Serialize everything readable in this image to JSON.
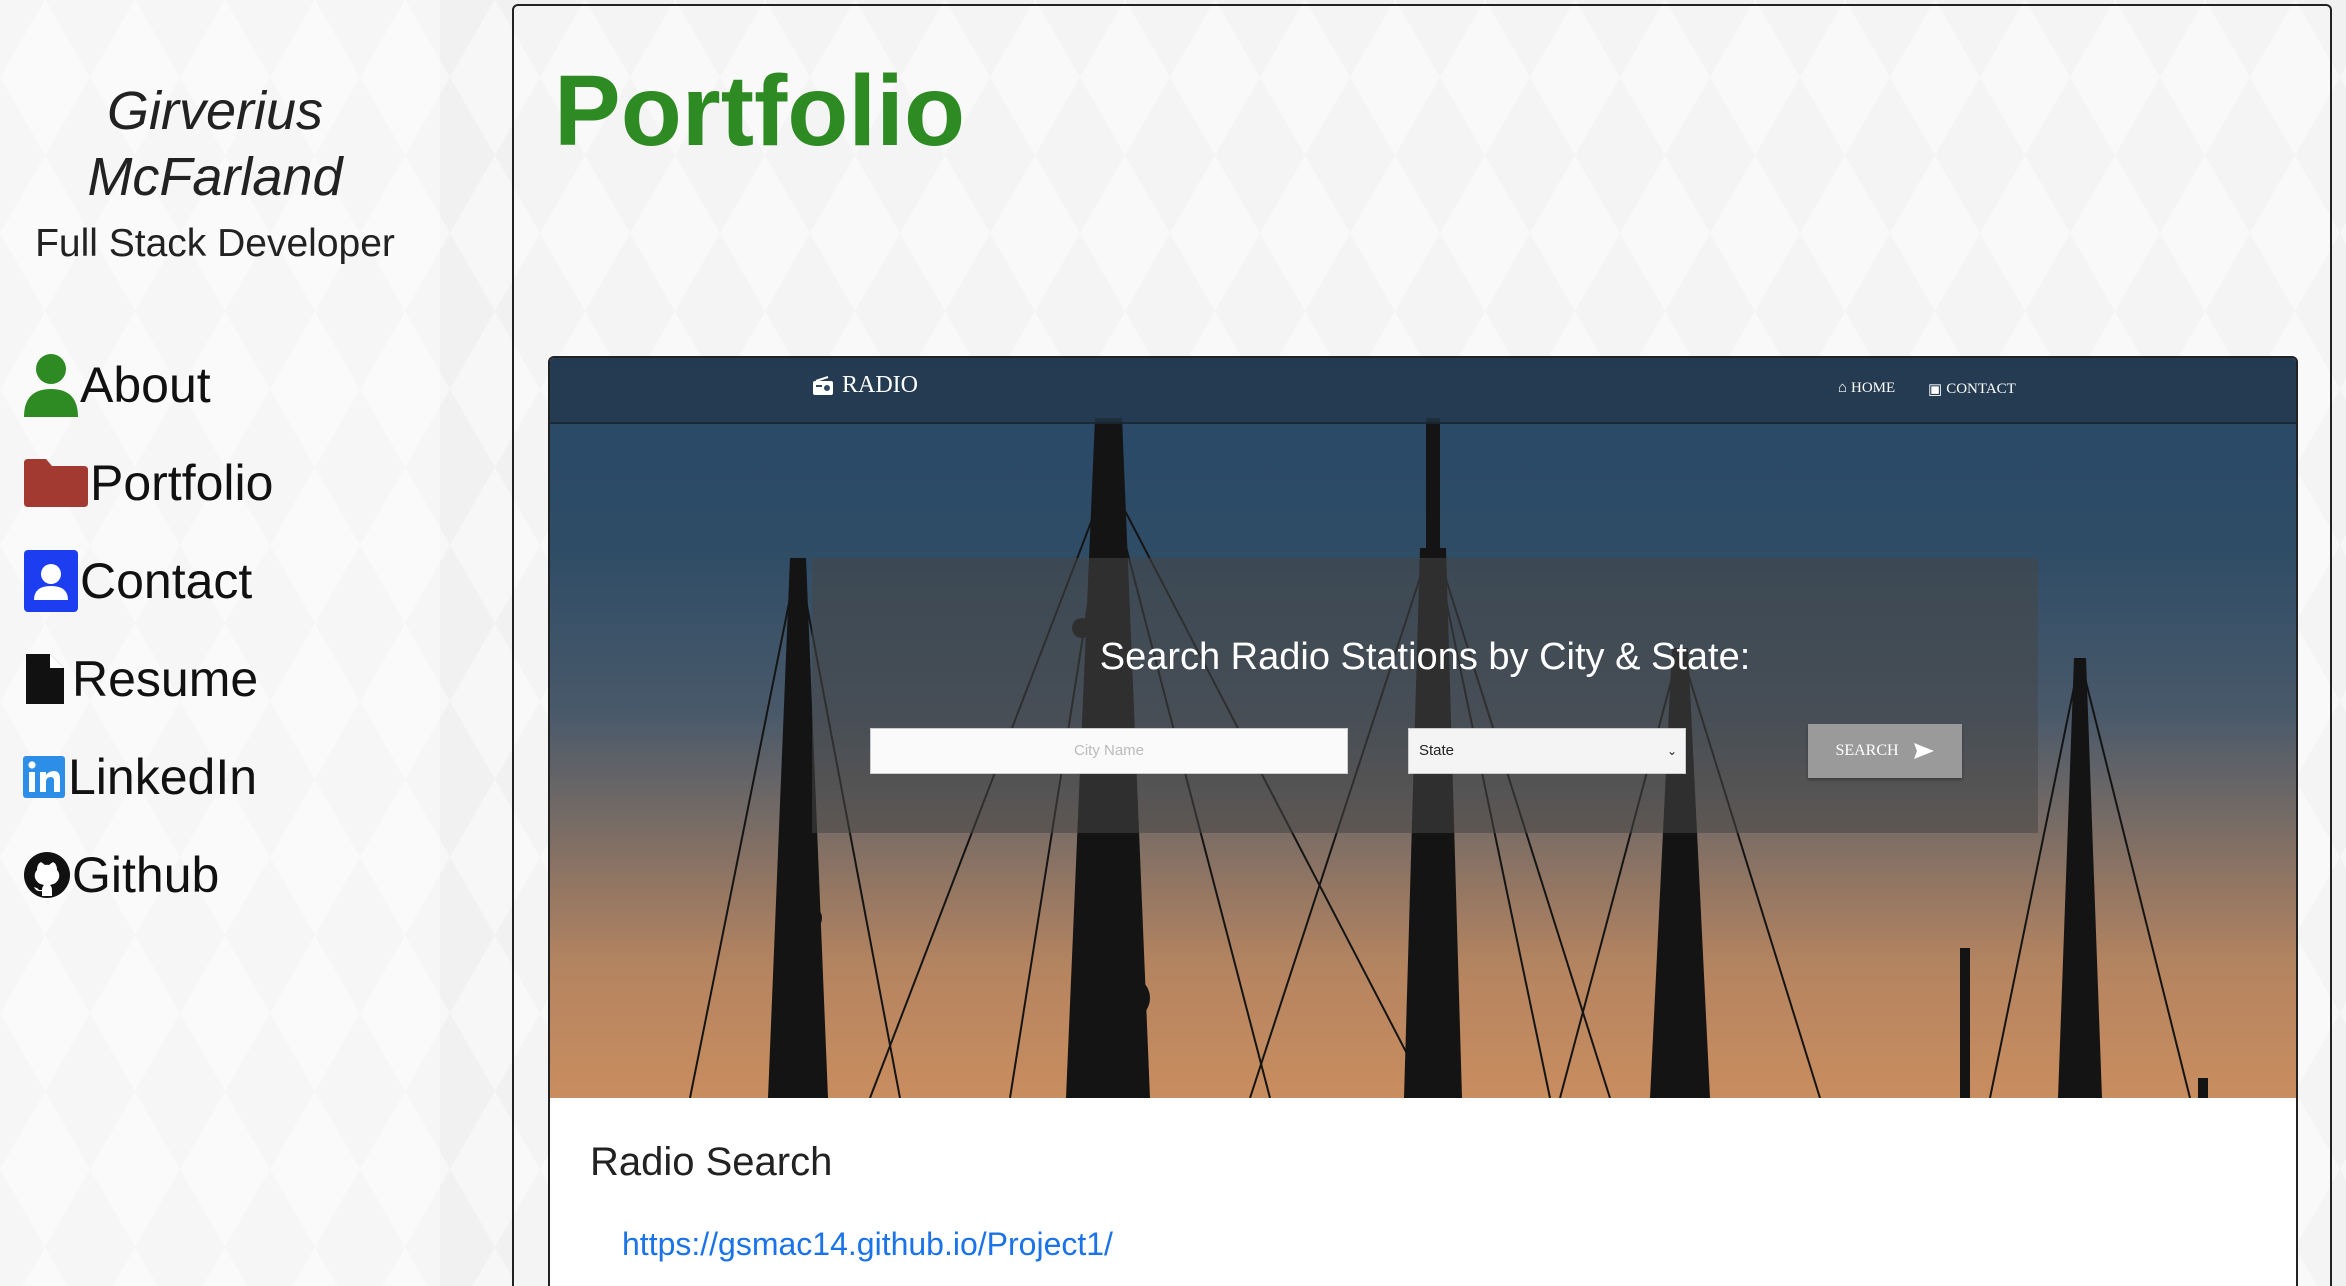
{
  "profile": {
    "name_first": "Girverius",
    "name_last": "McFarland",
    "role": "Full Stack Developer"
  },
  "nav": {
    "items": [
      {
        "label": "About",
        "icon": "person-icon",
        "color": "#2e8b23"
      },
      {
        "label": "Portfolio",
        "icon": "folder-icon",
        "color": "#a33a32"
      },
      {
        "label": "Contact",
        "icon": "contact-card-icon",
        "color": "#1c3ef0"
      },
      {
        "label": "Resume",
        "icon": "file-icon",
        "color": "#111111"
      },
      {
        "label": "LinkedIn",
        "icon": "linkedin-icon",
        "color": "#2d8ee8"
      },
      {
        "label": "Github",
        "icon": "github-icon",
        "color": "#111111"
      }
    ]
  },
  "main": {
    "title": "Portfolio",
    "title_color": "#2e8b23",
    "project": {
      "screenshot": {
        "brand": "RADIO",
        "nav_home": "HOME",
        "nav_contact": "CONTACT",
        "heading": "Search Radio Stations by City & State:",
        "city_placeholder": "City Name",
        "state_value": "State",
        "search_label": "SEARCH"
      },
      "title": "Radio Search",
      "link": "https://gsmac14.github.io/Project1/",
      "link_color": "#1a73e8"
    }
  }
}
